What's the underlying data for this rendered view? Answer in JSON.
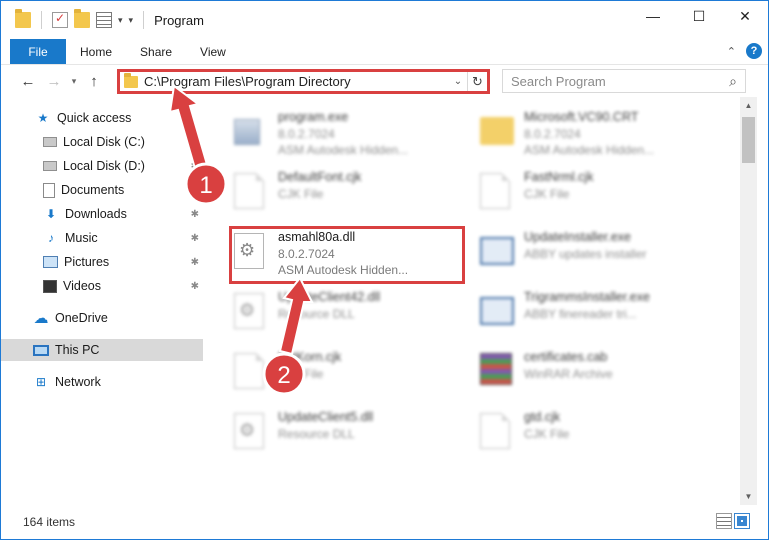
{
  "window": {
    "title": "Program",
    "controls": {
      "minimize": "—",
      "maximize": "☐",
      "close": "✕"
    }
  },
  "ribbon": {
    "tabs": [
      "File",
      "Home",
      "Share",
      "View"
    ],
    "help": "?"
  },
  "address": {
    "path": "C:\\Program Files\\Program Directory",
    "search_placeholder": "Search Program"
  },
  "sidebar": {
    "items": [
      {
        "label": "Quick access",
        "icon": "star-icon",
        "pinned": false
      },
      {
        "label": "Local Disk (C:)",
        "icon": "disk-icon",
        "pinned": true
      },
      {
        "label": "Local Disk (D:)",
        "icon": "disk-icon",
        "pinned": true
      },
      {
        "label": "Documents",
        "icon": "documents-icon",
        "pinned": true
      },
      {
        "label": "Downloads",
        "icon": "downloads-icon",
        "pinned": true
      },
      {
        "label": "Music",
        "icon": "music-icon",
        "pinned": true
      },
      {
        "label": "Pictures",
        "icon": "pictures-icon",
        "pinned": true
      },
      {
        "label": "Videos",
        "icon": "videos-icon",
        "pinned": true
      },
      {
        "label": "OneDrive",
        "icon": "onedrive-icon",
        "pinned": false
      },
      {
        "label": "This PC",
        "icon": "this-pc-icon",
        "pinned": false,
        "selected": true
      },
      {
        "label": "Network",
        "icon": "network-icon",
        "pinned": false
      }
    ]
  },
  "files": [
    {
      "name": "program.exe",
      "line2": "8.0.2.7024",
      "line3": "ASM Autodesk Hidden...",
      "icon": "exe-icon",
      "blurred": true
    },
    {
      "name": "Microsoft.VC90.CRT",
      "line2": "8.0.2.7024",
      "line3": "ASM Autodesk Hidden...",
      "icon": "folder-icon",
      "blurred": true
    },
    {
      "name": "DefaultFont.cjk",
      "line2": "CJK File",
      "line3": "",
      "icon": "file-icon",
      "blurred": true
    },
    {
      "name": "FastNrml.cjk",
      "line2": "CJK File",
      "line3": "",
      "icon": "file-icon",
      "blurred": true
    },
    {
      "name": "asmahl80a.dll",
      "line2": "8.0.2.7024",
      "line3": "ASM Autodesk Hidden...",
      "icon": "dll-icon",
      "blurred": false
    },
    {
      "name": "UpdateInstaller.exe",
      "line2": "ABBY updates installer",
      "line3": "",
      "icon": "installer-icon",
      "blurred": true
    },
    {
      "name": "UpdateClient42.dll",
      "line2": "Resource DLL",
      "line3": "",
      "icon": "dll-icon",
      "blurred": true
    },
    {
      "name": "TrigrammsInstaller.exe",
      "line2": "ABBY finereader tri...",
      "line3": "",
      "icon": "installer-icon",
      "blurred": true
    },
    {
      "name": "FntKorn.cjk",
      "line2": "CJK File",
      "line3": "",
      "icon": "file-icon",
      "blurred": true
    },
    {
      "name": "certificates.cab",
      "line2": "WinRAR Archive",
      "line3": "",
      "icon": "archive-icon",
      "blurred": true
    },
    {
      "name": "UpdateClient5.dll",
      "line2": "Resource DLL",
      "line3": "",
      "icon": "dll-icon",
      "blurred": true
    },
    {
      "name": "gtd.cjk",
      "line2": "CJK File",
      "line3": "",
      "icon": "file-icon",
      "blurred": true
    }
  ],
  "annotations": [
    "1",
    "2"
  ],
  "status": {
    "item_count": "164 items"
  },
  "colors": {
    "accent": "#1979ca",
    "annotation": "#d94040"
  }
}
